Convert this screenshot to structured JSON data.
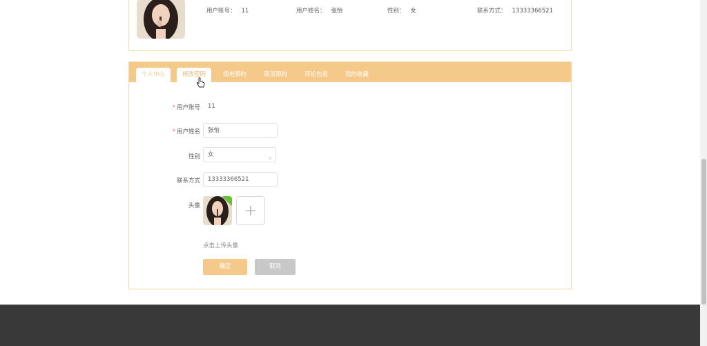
{
  "profile": {
    "account_label": "用户账号：",
    "account_value": "11",
    "name_label": "用户姓名：",
    "name_value": "张怡",
    "gender_label": "性别：",
    "gender_value": "女",
    "contact_label": "联系方式：",
    "contact_value": "13333366521"
  },
  "tabs": [
    {
      "label": "个人中心"
    },
    {
      "label": "修改密码"
    },
    {
      "label": "场地预约"
    },
    {
      "label": "取消预约"
    },
    {
      "label": "评论信息"
    },
    {
      "label": "我的收藏"
    }
  ],
  "form": {
    "account_label": "用户账号",
    "account_value": "11",
    "name_label": "用户姓名",
    "name_value": "张怡",
    "gender_label": "性别",
    "gender_value": "女",
    "contact_label": "联系方式",
    "contact_value": "13333366521",
    "avatar_label": "头像",
    "upload_hint": "点击上传头像",
    "confirm_label": "确定",
    "cancel_label": "取消"
  },
  "colors": {
    "accent": "#f5c98a",
    "border": "#f4dca9",
    "footer": "#393939"
  }
}
